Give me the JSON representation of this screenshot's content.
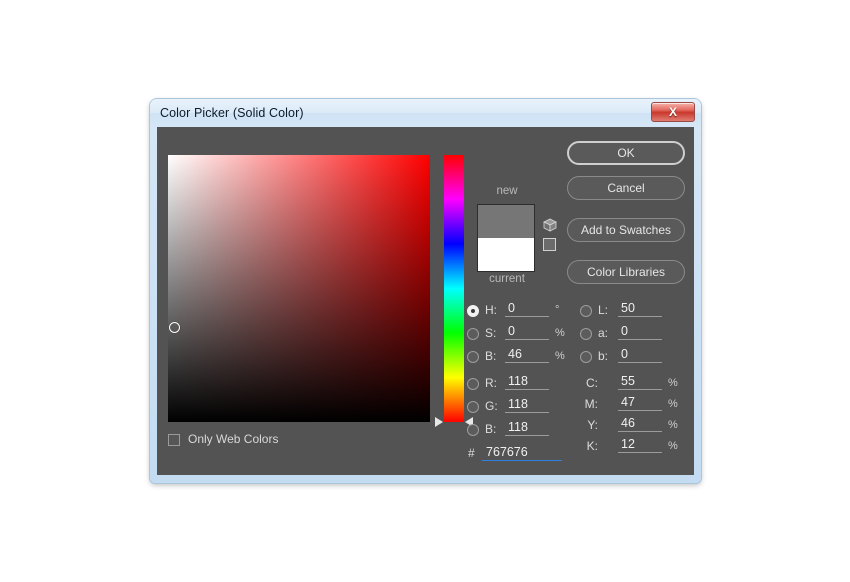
{
  "window": {
    "title": "Color Picker (Solid Color)",
    "close_glyph": "X",
    "frame_color": "#cfe3f5",
    "body_color": "#535353"
  },
  "picker": {
    "hue_degrees": 0,
    "marker_saturation_pct": 0,
    "marker_brightness_pct": 46,
    "field_base_color": "#ff0000"
  },
  "swatches": {
    "new_label": "new",
    "current_label": "current",
    "new_color": "#767676",
    "current_color": "#ffffff",
    "gamut_icon": "cube-icon",
    "web_icon": "web-safe-square-icon"
  },
  "buttons": {
    "ok": "OK",
    "cancel": "Cancel",
    "add_to_swatches": "Add to Swatches",
    "color_libraries": "Color Libraries"
  },
  "options": {
    "only_web_colors_label": "Only Web Colors",
    "only_web_colors_checked": false
  },
  "hsb": {
    "selected": "H",
    "rows": [
      {
        "key": "H",
        "label": "H:",
        "value": "0",
        "unit": "°",
        "radio": true
      },
      {
        "key": "S",
        "label": "S:",
        "value": "0",
        "unit": "%",
        "radio": true
      },
      {
        "key": "B",
        "label": "B:",
        "value": "46",
        "unit": "%",
        "radio": true
      }
    ]
  },
  "rgb": {
    "rows": [
      {
        "key": "R",
        "label": "R:",
        "value": "118",
        "unit": "",
        "radio": true
      },
      {
        "key": "G",
        "label": "G:",
        "value": "118",
        "unit": "",
        "radio": true
      },
      {
        "key": "Bb",
        "label": "B:",
        "value": "118",
        "unit": "",
        "radio": true
      }
    ]
  },
  "lab": {
    "rows": [
      {
        "key": "L",
        "label": "L:",
        "value": "50",
        "unit": "",
        "radio": true
      },
      {
        "key": "a",
        "label": "a:",
        "value": "0",
        "unit": "",
        "radio": true
      },
      {
        "key": "b",
        "label": "b:",
        "value": "0",
        "unit": "",
        "radio": true
      }
    ]
  },
  "cmyk": {
    "rows": [
      {
        "key": "C",
        "label": "C:",
        "value": "55",
        "unit": "%",
        "radio": false
      },
      {
        "key": "M",
        "label": "M:",
        "value": "47",
        "unit": "%",
        "radio": false
      },
      {
        "key": "Y",
        "label": "Y:",
        "value": "46",
        "unit": "%",
        "radio": false
      },
      {
        "key": "K",
        "label": "K:",
        "value": "12",
        "unit": "%",
        "radio": false
      }
    ]
  },
  "hex": {
    "hash": "#",
    "value": "767676"
  }
}
